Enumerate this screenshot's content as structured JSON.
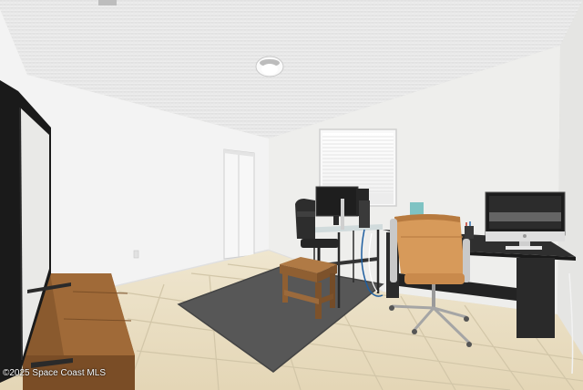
{
  "photo": {
    "watermark": "©2025 Space Coast MLS"
  },
  "palette": {
    "ceiling": "#ececec",
    "wall_left": "#f3f3f3",
    "wall_back": "#eeeeec",
    "wall_right": "#e6e6e4",
    "floor_tile": "#e8dcc0",
    "grout": "#cfc3a6",
    "rug": "#555555",
    "wood": "#9b6a3c",
    "chair_leather": "#d79a5a",
    "desk": "#2b2b2b",
    "screen": "#1c1c1c"
  }
}
